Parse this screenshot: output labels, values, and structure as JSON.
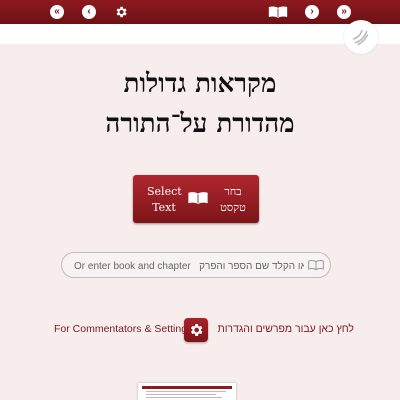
{
  "topbar": {
    "first_page_icon": "double-chevron-left-icon",
    "prev_icon": "chevron-left-icon",
    "settings_icon": "gear-icon",
    "book_icon": "open-book-icon",
    "next_icon": "chevron-right-icon",
    "last_page_icon": "double-chevron-right-icon"
  },
  "title": {
    "line1": "מקראות גדולות",
    "line2": "מהדורת על־התורה"
  },
  "select_text": {
    "label_en_line1": "Select",
    "label_en_line2": "Text",
    "label_he_line1": "בחר",
    "label_he_line2": "טקסט"
  },
  "search": {
    "placeholder": "Or enter book and chapter   או הקלד שם הספר והפרק"
  },
  "settings": {
    "label_en": "For Commentators & Settings",
    "label_he": "לחץ כאן עבור מפרשים והגדרות"
  },
  "colors": {
    "brand": "#8e1a1f",
    "background": "#f7eded"
  }
}
